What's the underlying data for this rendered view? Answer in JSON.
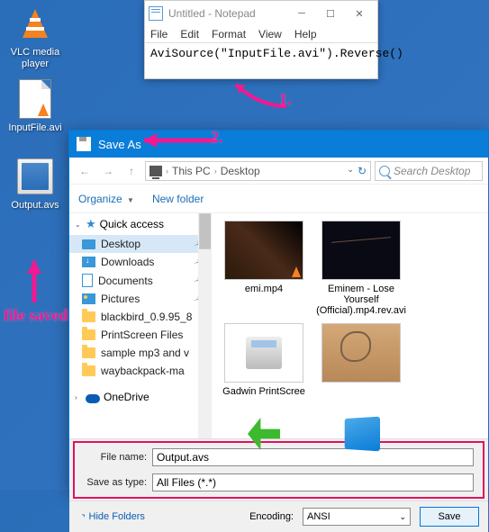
{
  "desktop": {
    "icons": [
      {
        "label": "VLC media player"
      },
      {
        "label": "InputFile.avi"
      },
      {
        "label": "Output.avs"
      }
    ]
  },
  "notepad": {
    "title": "Untitled - Notepad",
    "menu": [
      "File",
      "Edit",
      "Format",
      "View",
      "Help"
    ],
    "content": "AviSource(\"InputFile.avi\").Reverse()",
    "win_min": "─",
    "win_max": "☐",
    "win_close": "✕"
  },
  "saveas": {
    "title": "Save As",
    "breadcrumb": {
      "pc": "This PC",
      "folder": "Desktop"
    },
    "search_placeholder": "Search Desktop",
    "organize": "Organize",
    "new_folder": "New folder",
    "tree": {
      "quick": "Quick access",
      "desktop": "Desktop",
      "downloads": "Downloads",
      "documents": "Documents",
      "pictures": "Pictures",
      "blackbird": "blackbird_0.9.95_8",
      "printscreen": "PrintScreen Files",
      "sample": "sample mp3 and v",
      "wayback": "waybackpack-ma",
      "onedrive": "OneDrive"
    },
    "files": [
      {
        "name": "emi.mp4"
      },
      {
        "name": "Eminem - Lose Yourself (Official).mp4.rev.avi"
      },
      {
        "name": "Gadwin PrintScree"
      }
    ],
    "filename_label": "File name:",
    "filename_value": "Output.avs",
    "type_label": "Save as type:",
    "type_value": "All Files  (*.*)",
    "hide_folders": "Hide Folders",
    "encoding_label": "Encoding:",
    "encoding_value": "ANSI",
    "save_btn": "Save"
  },
  "annotations": {
    "one": "1.",
    "two": "2.",
    "saved": "file saved"
  }
}
